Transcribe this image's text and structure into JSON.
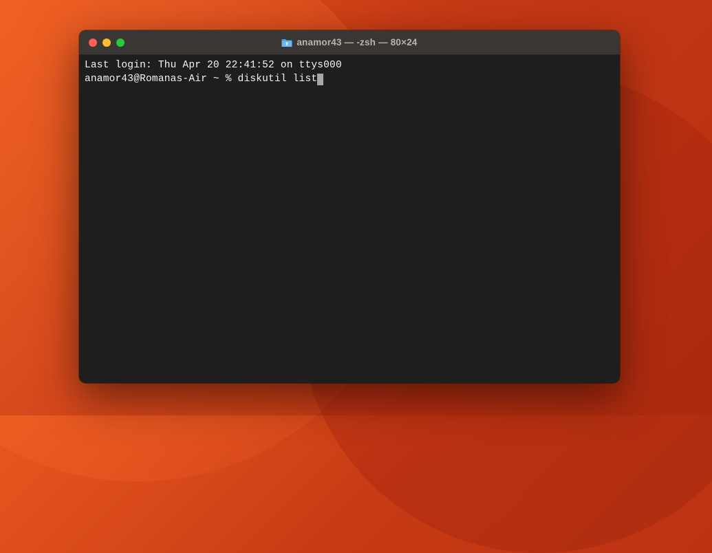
{
  "window": {
    "title": "anamor43 — -zsh — 80×24"
  },
  "terminal": {
    "last_login_line": "Last login: Thu Apr 20 22:41:52 on ttys000",
    "prompt": "anamor43@Romanas-Air ~ % ",
    "command": "diskutil list"
  }
}
